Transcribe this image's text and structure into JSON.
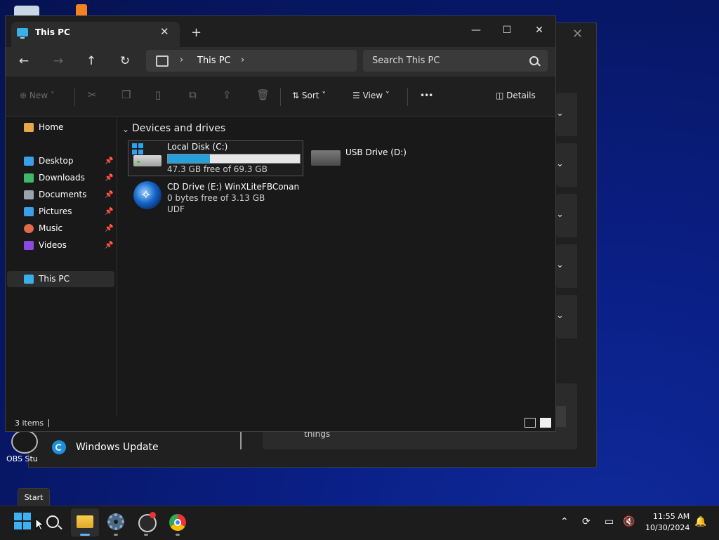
{
  "background_window": {
    "update_label": "Windows Update",
    "things_text": "things"
  },
  "desktop": {
    "obs_label": "OBS Stu"
  },
  "explorer": {
    "tab_title": "This PC",
    "window_controls": {
      "minimize": "—",
      "maximize": "☐",
      "close": "✕"
    },
    "nav": {
      "back": "←",
      "forward": "→",
      "up": "↑",
      "refresh": "↻"
    },
    "address": {
      "chevron1": "›",
      "location": "This PC",
      "chevron2": "›"
    },
    "search": {
      "placeholder": "Search This PC"
    },
    "toolbar": {
      "new_label": "New",
      "sort_label": "Sort",
      "view_label": "View",
      "more_label": "•••",
      "details_label": "Details"
    },
    "sidebar": {
      "home": "Home",
      "quick_access": [
        {
          "label": "Desktop",
          "color": "#3aa0e8"
        },
        {
          "label": "Downloads",
          "color": "#3fb86a"
        },
        {
          "label": "Documents",
          "color": "#9aa4b0"
        },
        {
          "label": "Pictures",
          "color": "#3aa0e8"
        },
        {
          "label": "Music",
          "color": "#e06a4a"
        },
        {
          "label": "Videos",
          "color": "#8a4ae0"
        }
      ],
      "this_pc": "This PC"
    },
    "group_header": "Devices and drives",
    "drives": [
      {
        "name": "Local Disk (C:)",
        "detail": "47.3 GB free of 69.3 GB",
        "used_fraction": 0.32
      },
      {
        "name": "USB Drive (D:)"
      },
      {
        "name": "CD Drive (E:) WinXLiteFBConan",
        "detail": "0 bytes free of 3.13 GB",
        "fs": "UDF"
      }
    ],
    "status_text": "3 items"
  },
  "tooltip": "Start",
  "taskbar": {
    "time": "11:55 AM",
    "date": "10/30/2024"
  }
}
